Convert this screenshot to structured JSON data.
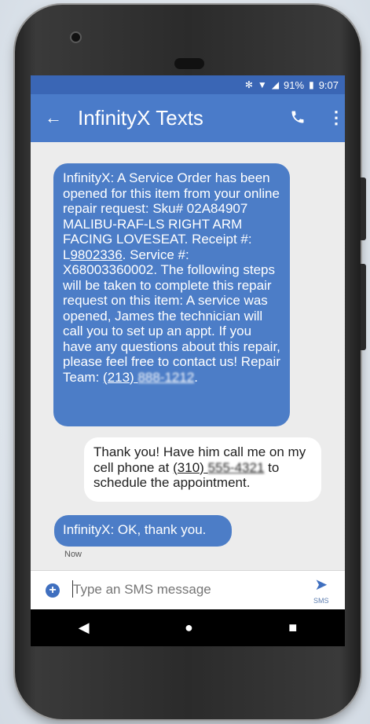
{
  "status_bar": {
    "battery": "91%",
    "time": "9:07"
  },
  "app_bar": {
    "title": "InfinityX Texts"
  },
  "messages": [
    {
      "direction": "incoming",
      "text": "InfinityX: A Service Order has been opened for this item from your online repair request: Sku# 02A84907 MALIBU-RAF-LS RIGHT ARM FACING LOVESEAT. Receipt #: L",
      "link1": "9802336",
      "text2": ". Service #: X68003360002. The following steps will be taken to complete this repair request on this item: A service was opened, James the technician will call you to set up an appt. If you have any questions about this repair, please feel free to contact us! Repair Team: ",
      "phone_area": "(213)",
      "phone_rest": "888-1212",
      "end": "."
    },
    {
      "direction": "outgoing",
      "text": "Thank you!  Have him call me on my cell phone at ",
      "phone_area": "(310)",
      "phone_rest": "555-4321",
      "text2": " to schedule the appointment."
    },
    {
      "direction": "incoming",
      "text": "InfinityX: OK, thank you."
    }
  ],
  "timestamp": "Now",
  "compose": {
    "placeholder": "Type an SMS message",
    "send_label": "SMS"
  },
  "nav": {
    "back": "◀",
    "home": "●",
    "recents": "■"
  },
  "colors": {
    "status_bar": "#3a66b5",
    "app_bar": "#4a7bc9",
    "incoming_bubble": "#4c7dc7",
    "outgoing_bubble": "#ffffff"
  }
}
